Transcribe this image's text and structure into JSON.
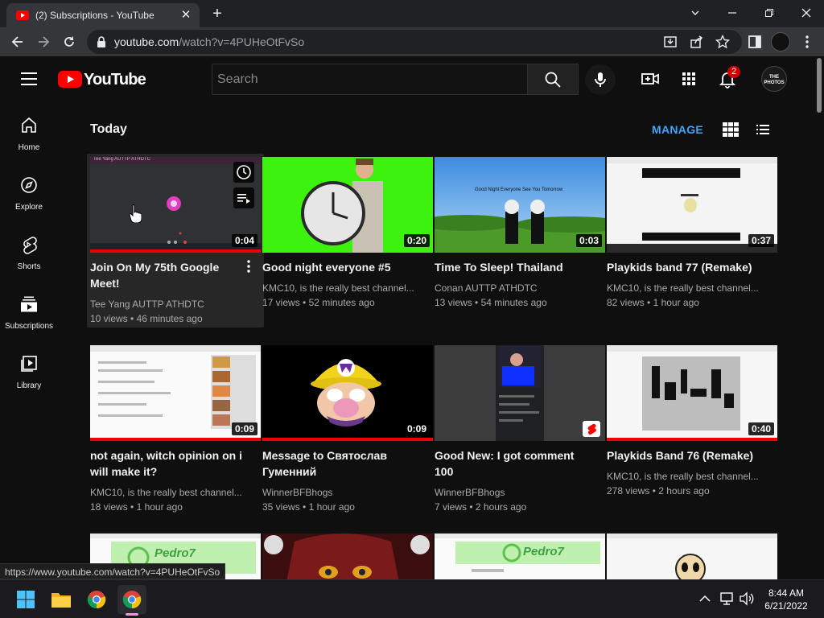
{
  "browser": {
    "tab_title": "(2) Subscriptions - YouTube",
    "url_host": "youtube.com",
    "url_rest": "/watch?v=4PUHeOtFvSo",
    "status_url": "https://www.youtube.com/watch?v=4PUHeOtFvSo"
  },
  "masthead": {
    "logo_text": "YouTube",
    "search_placeholder": "Search",
    "notification_count": "2",
    "avatar_text": "THE PHOTOS"
  },
  "sidebar": {
    "items": [
      {
        "label": "Home",
        "icon": "home-icon"
      },
      {
        "label": "Explore",
        "icon": "compass-icon"
      },
      {
        "label": "Shorts",
        "icon": "shorts-icon"
      },
      {
        "label": "Subscriptions",
        "icon": "subscriptions-icon"
      },
      {
        "label": "Library",
        "icon": "library-icon"
      }
    ]
  },
  "feed": {
    "section_title": "Today",
    "manage_label": "MANAGE",
    "videos": [
      {
        "title": "Join On My 75th Google Meet!",
        "channel": "Tee Yang AUTTP ATHDTC",
        "views": "10 views",
        "age": "46 minutes ago",
        "duration": "0:04",
        "thumb_text": "Tee Yang AUTTP ATHDTC"
      },
      {
        "title": "Good night everyone #5",
        "channel": "KMC10, is the really best channel...",
        "views": "17 views",
        "age": "52 minutes ago",
        "duration": "0:20"
      },
      {
        "title": "Time To Sleep! Thailand",
        "channel": "Conan AUTTP ATHDTC",
        "views": "13 views",
        "age": "54 minutes ago",
        "duration": "0:03",
        "thumb_text": "Good Night Everyone See You Tomorrow"
      },
      {
        "title": "Playkids band 77 (Remake)",
        "channel": "KMC10, is the really best channel...",
        "views": "82 views",
        "age": "1 hour ago",
        "duration": "0:37"
      },
      {
        "title": "not again, witch opinion on i will make it?",
        "channel": "KMC10, is the really best channel...",
        "views": "18 views",
        "age": "1 hour ago",
        "duration": "0:09"
      },
      {
        "title": "Message to Святослав Гуменний",
        "channel": "WinnerBFBhogs",
        "views": "35 views",
        "age": "1 hour ago",
        "duration": "0:09"
      },
      {
        "title": "Good New: I got comment 100",
        "channel": "WinnerBFBhogs",
        "views": "7 views",
        "age": "2 hours ago",
        "duration": ""
      },
      {
        "title": "Playkids Band 76 (Remake)",
        "channel": "KMC10, is the really best channel...",
        "views": "278 views",
        "age": "2 hours ago",
        "duration": "0:40"
      }
    ],
    "row3_thumb_text": [
      "Pedro7",
      "Pedro7"
    ]
  },
  "taskbar": {
    "time": "8:44 AM",
    "date": "6/21/2022"
  },
  "colors": {
    "background": "#0f0f0f",
    "accent_blue": "#3ea6ff",
    "youtube_red": "#ff0000",
    "progress_red": "#e00000"
  }
}
